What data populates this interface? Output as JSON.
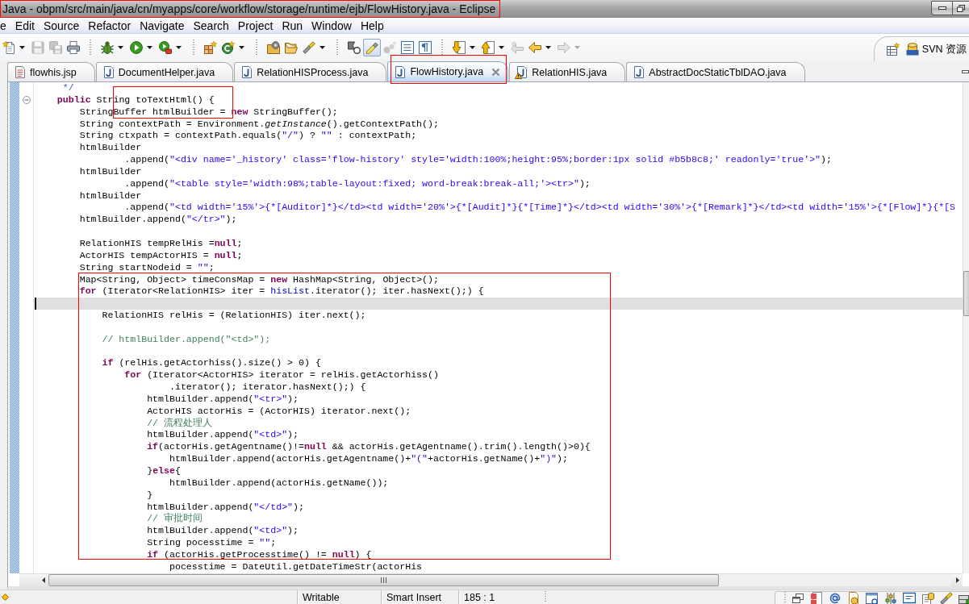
{
  "window": {
    "title": "Java - obpm/src/main/java/cn/myapps/core/workflow/storage/runtime/ejb/FlowHistory.java - Eclipse"
  },
  "menu": [
    "e",
    "Edit",
    "Source",
    "Refactor",
    "Navigate",
    "Search",
    "Project",
    "Run",
    "Window",
    "Help"
  ],
  "toolbar": {
    "groups": [
      [
        {
          "menu": true,
          "disabled": false,
          "pressed": false
        },
        {
          "menu": false,
          "disabled": true,
          "pressed": false
        },
        {
          "menu": false,
          "disabled": true,
          "pressed": false
        },
        {
          "menu": false,
          "disabled": false,
          "pressed": false
        }
      ],
      [
        {
          "menu": true,
          "disabled": false,
          "pressed": false
        },
        {
          "menu": true,
          "disabled": false,
          "pressed": false
        },
        {
          "menu": true,
          "disabled": false,
          "pressed": false
        }
      ],
      [
        {
          "menu": false,
          "disabled": false,
          "pressed": false
        },
        {
          "menu": true,
          "disabled": false,
          "pressed": false
        }
      ],
      [
        {
          "menu": false,
          "disabled": false,
          "pressed": false
        },
        {
          "menu": false,
          "disabled": false,
          "pressed": false
        },
        {
          "menu": true,
          "disabled": false,
          "pressed": false
        }
      ],
      [
        {
          "menu": false,
          "disabled": false,
          "pressed": false
        },
        {
          "menu": false,
          "disabled": false,
          "pressed": true
        },
        {
          "menu": false,
          "disabled": true,
          "pressed": false
        },
        {
          "menu": false,
          "disabled": false,
          "pressed": false
        },
        {
          "menu": false,
          "disabled": false,
          "pressed": false
        }
      ],
      [
        {
          "menu": true,
          "disabled": false,
          "pressed": false
        },
        {
          "menu": true,
          "disabled": false,
          "pressed": false
        },
        {
          "menu": false,
          "disabled": true,
          "pressed": false
        },
        {
          "menu": true,
          "disabled": false,
          "pressed": false
        },
        {
          "menu": true,
          "disabled": true,
          "pressed": false
        }
      ]
    ],
    "perspective": {
      "label": "SVN 资源"
    }
  },
  "tabs": [
    {
      "label": "flowhis.jsp",
      "kind": "jsp",
      "selected": false,
      "warning": false
    },
    {
      "label": "DocumentHelper.java",
      "kind": "java",
      "selected": false,
      "warning": false
    },
    {
      "label": "RelationHISProcess.java",
      "kind": "java",
      "selected": false,
      "warning": false
    },
    {
      "label": "FlowHistory.java",
      "kind": "java",
      "selected": true,
      "warning": false
    },
    {
      "label": "RelationHIS.java",
      "kind": "java",
      "selected": false,
      "warning": true
    },
    {
      "label": "AbstractDocStaticTblDAO.java",
      "kind": "java",
      "selected": false,
      "warning": false
    }
  ],
  "editor": {
    "lines": [
      {
        "kind": "code",
        "current": false,
        "parts": [
          {
            "kind": "doc",
            "text": "     */"
          }
        ]
      },
      {
        "kind": "code",
        "current": false,
        "expanded": true,
        "parts": [
          {
            "kind": "keyword",
            "text": "    public"
          },
          {
            "kind": "plain",
            "text": " String toTextHtml() {"
          }
        ]
      },
      {
        "kind": "code",
        "current": false,
        "parts": [
          {
            "kind": "plain",
            "text": "        StringBuffer htmlBuilder = "
          },
          {
            "kind": "keyword",
            "text": "new"
          },
          {
            "kind": "plain",
            "text": " StringBuffer();"
          }
        ]
      },
      {
        "kind": "code",
        "current": false,
        "parts": [
          {
            "kind": "plain",
            "text": "        String contextPath = Environment."
          },
          {
            "kind": "static",
            "text": "getInstance"
          },
          {
            "kind": "plain",
            "text": "().getContextPath();"
          }
        ]
      },
      {
        "kind": "code",
        "current": false,
        "parts": [
          {
            "kind": "plain",
            "text": "        String ctxpath = contextPath.equals("
          },
          {
            "kind": "string",
            "text": "\"/\""
          },
          {
            "kind": "plain",
            "text": ") ? "
          },
          {
            "kind": "string",
            "text": "\"\""
          },
          {
            "kind": "plain",
            "text": " : contextPath;"
          }
        ]
      },
      {
        "kind": "code",
        "current": false,
        "parts": [
          {
            "kind": "plain",
            "text": "        htmlBuilder"
          }
        ]
      },
      {
        "kind": "code",
        "current": false,
        "parts": [
          {
            "kind": "plain",
            "text": "                .append("
          },
          {
            "kind": "string",
            "text": "\"<div name='_history' class='flow-history' style='width:100%;height:95%;border:1px solid #b5b8c8;' readonly='true'>\""
          },
          {
            "kind": "plain",
            "text": ");"
          }
        ]
      },
      {
        "kind": "code",
        "current": false,
        "parts": [
          {
            "kind": "plain",
            "text": "        htmlBuilder"
          }
        ]
      },
      {
        "kind": "code",
        "current": false,
        "parts": [
          {
            "kind": "plain",
            "text": "                .append("
          },
          {
            "kind": "string",
            "text": "\"<table style='width:98%;table-layout:fixed; word-break:break-all;'><tr>\""
          },
          {
            "kind": "plain",
            "text": ");"
          }
        ]
      },
      {
        "kind": "code",
        "current": false,
        "parts": [
          {
            "kind": "plain",
            "text": "        htmlBuilder"
          }
        ]
      },
      {
        "kind": "code",
        "current": false,
        "parts": [
          {
            "kind": "plain",
            "text": "                .append("
          },
          {
            "kind": "string",
            "text": "\"<td width='15%'>{*[Auditor]*}</td><td width='20%'>{*[Audit]*}{*[Time]*}</td><td width='30%'>{*[Remark]*}</td><td width='15%'>{*[Flow]*}{*[S"
          }
        ]
      },
      {
        "kind": "code",
        "current": false,
        "parts": [
          {
            "kind": "plain",
            "text": "        htmlBuilder.append("
          },
          {
            "kind": "string",
            "text": "\"</tr>\""
          },
          {
            "kind": "plain",
            "text": ");"
          }
        ]
      },
      {
        "kind": "blank",
        "current": false
      },
      {
        "kind": "code",
        "current": false,
        "parts": [
          {
            "kind": "plain",
            "text": "        RelationHIS tempRelHis ="
          },
          {
            "kind": "keyword",
            "text": "null"
          },
          {
            "kind": "plain",
            "text": ";"
          }
        ]
      },
      {
        "kind": "code",
        "current": false,
        "parts": [
          {
            "kind": "plain",
            "text": "        ActorHIS tempActorHIS = "
          },
          {
            "kind": "keyword",
            "text": "null"
          },
          {
            "kind": "plain",
            "text": ";"
          }
        ]
      },
      {
        "kind": "code",
        "current": false,
        "parts": [
          {
            "kind": "plain",
            "text": "        String startNodeid = "
          },
          {
            "kind": "string",
            "text": "\"\""
          },
          {
            "kind": "plain",
            "text": ";"
          }
        ]
      },
      {
        "kind": "code",
        "current": false,
        "parts": [
          {
            "kind": "plain",
            "text": "        Map<String, Object> timeConsMap = "
          },
          {
            "kind": "keyword",
            "text": "new"
          },
          {
            "kind": "plain",
            "text": " HashMap<String, Object>();"
          }
        ]
      },
      {
        "kind": "code",
        "current": false,
        "parts": [
          {
            "kind": "keyword",
            "text": "        for"
          },
          {
            "kind": "plain",
            "text": " (Iterator<RelationHIS> iter = "
          },
          {
            "kind": "field",
            "text": "hisList"
          },
          {
            "kind": "plain",
            "text": ".iterator(); iter.hasNext();) {"
          }
        ]
      },
      {
        "kind": "blank",
        "current": true
      },
      {
        "kind": "code",
        "current": false,
        "parts": [
          {
            "kind": "plain",
            "text": "            RelationHIS relHis = (RelationHIS) iter.next();"
          }
        ]
      },
      {
        "kind": "blank",
        "current": false
      },
      {
        "kind": "code",
        "current": false,
        "parts": [
          {
            "kind": "comment",
            "text": "            // htmlBuilder.append(\"<td>\");"
          }
        ]
      },
      {
        "kind": "blank",
        "current": false
      },
      {
        "kind": "code",
        "current": false,
        "parts": [
          {
            "kind": "keyword",
            "text": "            if"
          },
          {
            "kind": "plain",
            "text": " (relHis.getActorhiss().size() > 0) {"
          }
        ]
      },
      {
        "kind": "code",
        "current": false,
        "parts": [
          {
            "kind": "keyword",
            "text": "                for"
          },
          {
            "kind": "plain",
            "text": " (Iterator<ActorHIS> iterator = relHis.getActorhiss()"
          }
        ]
      },
      {
        "kind": "code",
        "current": false,
        "parts": [
          {
            "kind": "plain",
            "text": "                        .iterator(); iterator.hasNext();) {"
          }
        ]
      },
      {
        "kind": "code",
        "current": false,
        "parts": [
          {
            "kind": "plain",
            "text": "                    htmlBuilder.append("
          },
          {
            "kind": "string",
            "text": "\"<tr>\""
          },
          {
            "kind": "plain",
            "text": ");"
          }
        ]
      },
      {
        "kind": "code",
        "current": false,
        "parts": [
          {
            "kind": "plain",
            "text": "                    ActorHIS actorHis = (ActorHIS) iterator.next();"
          }
        ]
      },
      {
        "kind": "code",
        "current": false,
        "parts": [
          {
            "kind": "comment",
            "text": "                    // 流程处理人"
          }
        ]
      },
      {
        "kind": "code",
        "current": false,
        "parts": [
          {
            "kind": "plain",
            "text": "                    htmlBuilder.append("
          },
          {
            "kind": "string",
            "text": "\"<td>\""
          },
          {
            "kind": "plain",
            "text": ");"
          }
        ]
      },
      {
        "kind": "code",
        "current": false,
        "parts": [
          {
            "kind": "keyword",
            "text": "                    if"
          },
          {
            "kind": "plain",
            "text": "(actorHis.getAgentname()!="
          },
          {
            "kind": "keyword",
            "text": "null"
          },
          {
            "kind": "plain",
            "text": " && actorHis.getAgentname().trim().length()>0){"
          }
        ]
      },
      {
        "kind": "code",
        "current": false,
        "parts": [
          {
            "kind": "plain",
            "text": "                        htmlBuilder.append(actorHis.getAgentname()+"
          },
          {
            "kind": "string",
            "text": "\"(\""
          },
          {
            "kind": "plain",
            "text": "+actorHis.getName()+"
          },
          {
            "kind": "string",
            "text": "\")\""
          },
          {
            "kind": "plain",
            "text": ");"
          }
        ]
      },
      {
        "kind": "code",
        "current": false,
        "parts": [
          {
            "kind": "plain",
            "text": "                    }"
          },
          {
            "kind": "keyword",
            "text": "else"
          },
          {
            "kind": "plain",
            "text": "{"
          }
        ]
      },
      {
        "kind": "code",
        "current": false,
        "parts": [
          {
            "kind": "plain",
            "text": "                        htmlBuilder.append(actorHis.getName());"
          }
        ]
      },
      {
        "kind": "code",
        "current": false,
        "parts": [
          {
            "kind": "plain",
            "text": "                    }"
          }
        ]
      },
      {
        "kind": "code",
        "current": false,
        "parts": [
          {
            "kind": "plain",
            "text": "                    htmlBuilder.append("
          },
          {
            "kind": "string",
            "text": "\"</td>\""
          },
          {
            "kind": "plain",
            "text": ");"
          }
        ]
      },
      {
        "kind": "code",
        "current": false,
        "parts": [
          {
            "kind": "comment",
            "text": "                    // 审批时间"
          }
        ]
      },
      {
        "kind": "code",
        "current": false,
        "parts": [
          {
            "kind": "plain",
            "text": "                    htmlBuilder.append("
          },
          {
            "kind": "string",
            "text": "\"<td>\""
          },
          {
            "kind": "plain",
            "text": ");"
          }
        ]
      },
      {
        "kind": "code",
        "current": false,
        "parts": [
          {
            "kind": "plain",
            "text": "                    String pocesstime = "
          },
          {
            "kind": "string",
            "text": "\"\""
          },
          {
            "kind": "plain",
            "text": ";"
          }
        ]
      },
      {
        "kind": "code",
        "current": false,
        "parts": [
          {
            "kind": "keyword",
            "text": "                    if"
          },
          {
            "kind": "plain",
            "text": " (actorHis.getProcesstime() != "
          },
          {
            "kind": "keyword",
            "text": "null"
          },
          {
            "kind": "plain",
            "text": ") {"
          }
        ]
      },
      {
        "kind": "code",
        "current": false,
        "parts": [
          {
            "kind": "plain",
            "text": "                        pocesstime = DateUtil.getDateTimeStr(actorHis"
          }
        ]
      }
    ]
  },
  "status_bar": {
    "fields": [
      "Writable",
      "Smart Insert",
      "185 : 1"
    ]
  },
  "annotations": [
    {
      "kind": "rectangle"
    },
    {
      "kind": "rectangle"
    },
    {
      "kind": "rectangle"
    },
    {
      "kind": "rectangle"
    }
  ]
}
